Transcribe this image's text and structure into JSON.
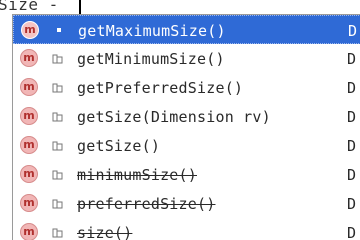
{
  "editor": {
    "text": "Size",
    "operator": "-"
  },
  "completion": {
    "items": [
      {
        "icon": "m",
        "label": "getMaximumSize()",
        "type": "D",
        "deprecated": false,
        "selected": true
      },
      {
        "icon": "m",
        "label": "getMinimumSize()",
        "type": "D",
        "deprecated": false,
        "selected": false
      },
      {
        "icon": "m",
        "label": "getPreferredSize()",
        "type": "D",
        "deprecated": false,
        "selected": false
      },
      {
        "icon": "m",
        "label": "getSize(Dimension rv)",
        "type": "D",
        "deprecated": false,
        "selected": false
      },
      {
        "icon": "m",
        "label": "getSize()",
        "type": "D",
        "deprecated": false,
        "selected": false
      },
      {
        "icon": "m",
        "label": "minimumSize()",
        "type": "D",
        "deprecated": true,
        "selected": false
      },
      {
        "icon": "m",
        "label": "preferredSize()",
        "type": "D",
        "deprecated": true,
        "selected": false
      },
      {
        "icon": "m",
        "label": "size()",
        "type": "D",
        "deprecated": true,
        "selected": false
      }
    ]
  },
  "colors": {
    "selection": "#2f6ad6",
    "method_icon": "#f1b6b6"
  }
}
